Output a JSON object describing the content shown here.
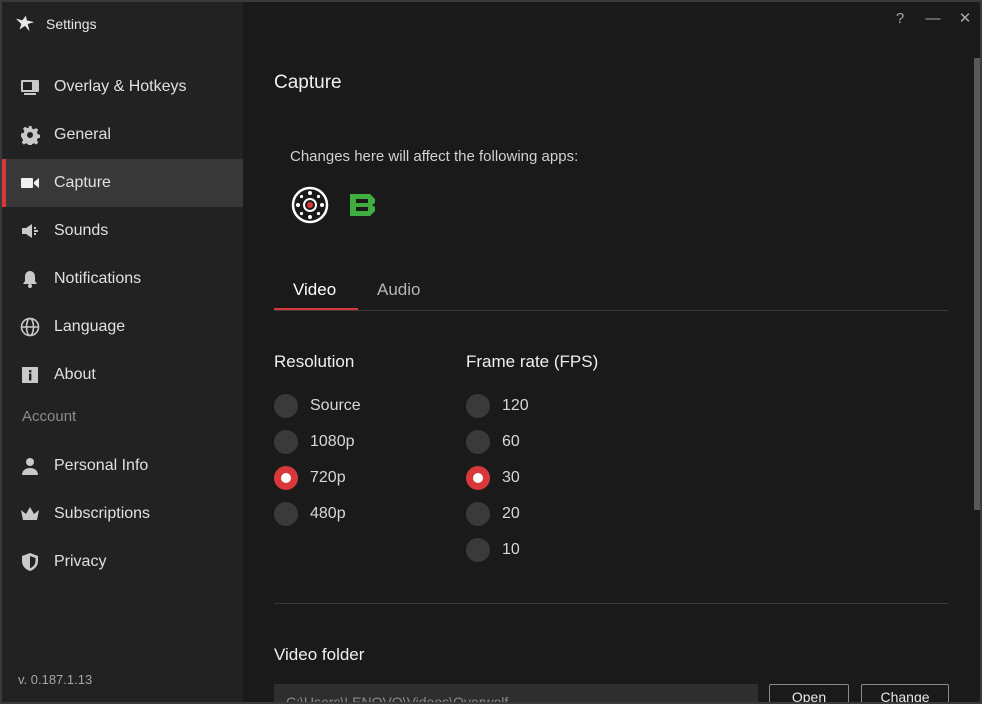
{
  "app": {
    "title": "Settings",
    "version": "v. 0.187.1.13"
  },
  "window_controls": {
    "help": "?",
    "minimize": "—",
    "close": "✕"
  },
  "sidebar": {
    "items": [
      {
        "label": "Overlay & Hotkeys",
        "icon": "monitor-icon"
      },
      {
        "label": "General",
        "icon": "gear-icon"
      },
      {
        "label": "Capture",
        "icon": "video-camera-icon",
        "active": true
      },
      {
        "label": "Sounds",
        "icon": "speaker-icon"
      },
      {
        "label": "Notifications",
        "icon": "bell-icon"
      },
      {
        "label": "Language",
        "icon": "globe-icon"
      },
      {
        "label": "About",
        "icon": "info-icon"
      }
    ],
    "account_label": "Account",
    "account_items": [
      {
        "label": "Personal Info",
        "icon": "person-icon"
      },
      {
        "label": "Subscriptions",
        "icon": "crown-icon"
      },
      {
        "label": "Privacy",
        "icon": "shield-icon"
      }
    ]
  },
  "main": {
    "title": "Capture",
    "apps_text": "Changes here will affect the following apps:",
    "apps": [
      {
        "icon": "capture-app-icon"
      },
      {
        "icon": "green-b-app-icon"
      }
    ],
    "tabs": [
      {
        "label": "Video",
        "active": true
      },
      {
        "label": "Audio",
        "active": false
      }
    ],
    "resolution": {
      "title": "Resolution",
      "options": [
        "Source",
        "1080p",
        "720p",
        "480p"
      ],
      "selected": "720p"
    },
    "framerate": {
      "title": "Frame rate (FPS)",
      "options": [
        "120",
        "60",
        "30",
        "20",
        "10"
      ],
      "selected": "30"
    },
    "video_folder": {
      "title": "Video folder",
      "path": "C:\\Users\\LENOVO\\Videos\\Overwolf",
      "open_label": "Open",
      "change_label": "Change"
    }
  },
  "colors": {
    "accent": "#d9383a",
    "sidebar_bg": "#222222",
    "main_bg": "#1a1a1a",
    "active_item_bg": "#383838",
    "green_app": "#3fae3f"
  }
}
